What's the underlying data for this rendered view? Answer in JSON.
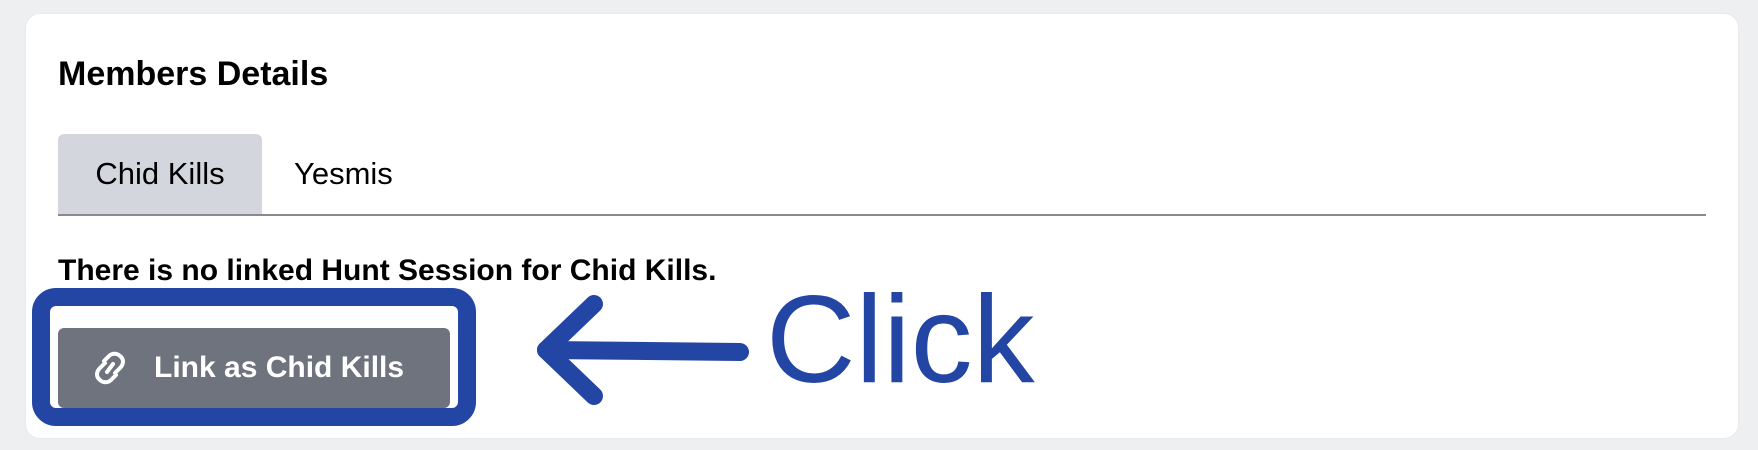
{
  "panel": {
    "title": "Members Details"
  },
  "tabs": [
    {
      "label": "Chid Kills",
      "active": true
    },
    {
      "label": "Yesmis",
      "active": false
    }
  ],
  "message": "There is no linked Hunt Session for Chid Kills.",
  "link_button": {
    "label": "Link as Chid Kills",
    "icon": "link-icon"
  },
  "annotation": {
    "text": "Click",
    "color": "#2346a4"
  },
  "colors": {
    "active_tab": "#d3d6dd",
    "button_bg": "#6f737d",
    "annotation": "#2346a4"
  }
}
